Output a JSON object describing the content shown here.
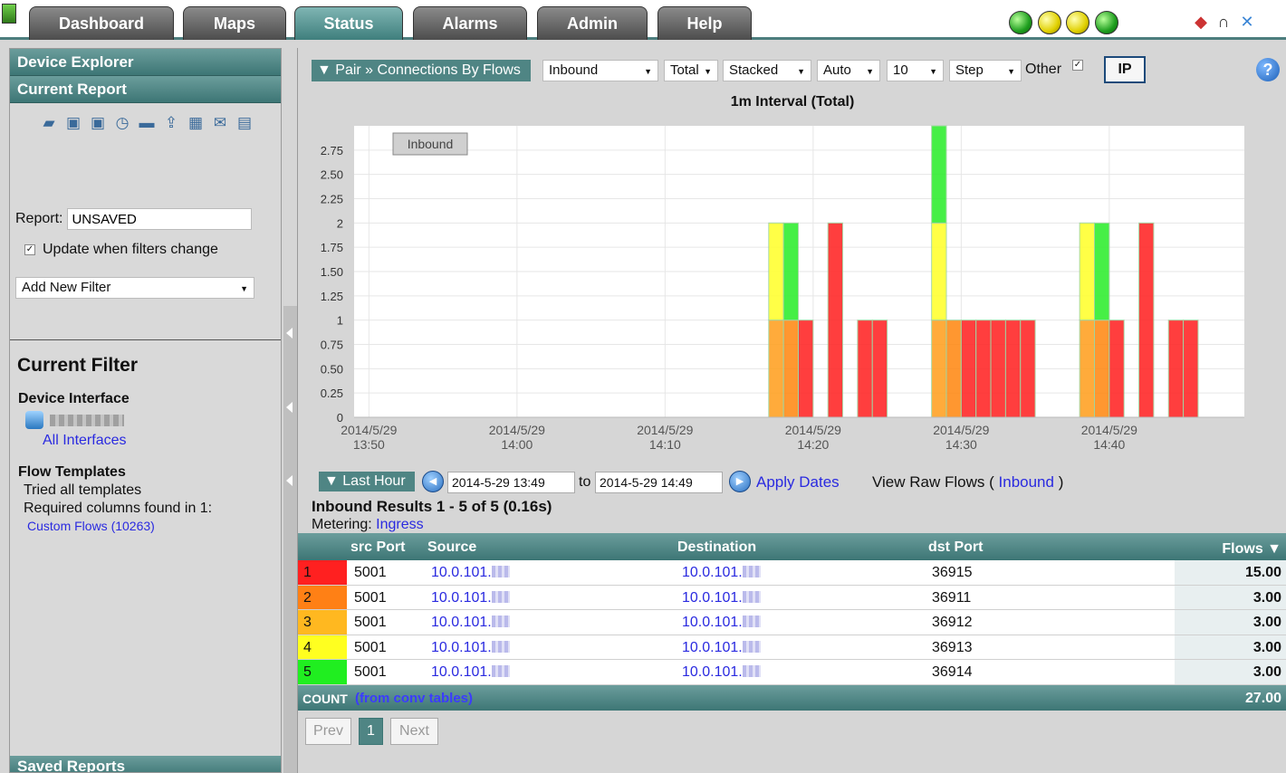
{
  "nav": {
    "tabs": [
      "Dashboard",
      "Maps",
      "Status",
      "Alarms",
      "Admin",
      "Help"
    ],
    "active_tab": "Status",
    "status_lights": [
      "green",
      "yellow",
      "yellow",
      "green"
    ],
    "tool_icons": [
      "alert-diamond-icon",
      "binoculars-icon",
      "tools-icon"
    ]
  },
  "sidebar": {
    "device_explorer": "Device Explorer",
    "current_report": "Current Report",
    "icons": [
      "open-icon",
      "save-icon",
      "save-as-icon",
      "schedule-icon",
      "print-icon",
      "export-icon",
      "table-icon",
      "email-icon",
      "pdf-icon"
    ],
    "report_label": "Report:",
    "report_value": "UNSAVED",
    "update_label": "Update when filters change",
    "update_checked": true,
    "add_filter": "Add New Filter",
    "current_filter_title": "Current Filter",
    "device_interface_label": "Device Interface",
    "all_interfaces": "All Interfaces",
    "flow_templates_label": "Flow Templates",
    "tried_all": "Tried all templates",
    "required_columns": "Required columns found in 1:",
    "custom_flows": "Custom Flows (10263)",
    "saved_reports": "Saved Reports"
  },
  "toolbar": {
    "breadcrumb": "▼ Pair » Connections By Flows",
    "direction": "Inbound",
    "total": "Total",
    "stacked": "Stacked",
    "auto": "Auto",
    "ten": "10",
    "step": "Step",
    "other_label": "Other",
    "other_checked": true,
    "ip_button": "IP",
    "help": "?"
  },
  "chart_data": {
    "type": "bar",
    "title": "1m Interval (Total)",
    "legend_label": "Inbound",
    "stacked": true,
    "ylim": [
      0,
      3
    ],
    "y_ticks": [
      "0",
      "0.25",
      "0.50",
      "0.75",
      "1",
      "1.25",
      "1.50",
      "1.75",
      "2",
      "2.25",
      "2.50",
      "2.75"
    ],
    "x_ticks": [
      [
        "2014/5/29",
        "13:50"
      ],
      [
        "2014/5/29",
        "14:00"
      ],
      [
        "2014/5/29",
        "14:10"
      ],
      [
        "2014/5/29",
        "14:20"
      ],
      [
        "2014/5/29",
        "14:30"
      ],
      [
        "2014/5/29",
        "14:40"
      ]
    ],
    "x_start": "13:49",
    "series_colors": [
      "#ff2a2a",
      "#ff8c1a",
      "#ffb833",
      "#ffff33",
      "#33ee33"
    ],
    "bars": [
      {
        "t": "14:17",
        "orange": 1,
        "yellow": 1
      },
      {
        "t": "14:18",
        "amber": 1,
        "green": 1
      },
      {
        "t": "14:19",
        "red": 1
      },
      {
        "t": "14:21",
        "red": 2
      },
      {
        "t": "14:23",
        "red": 1
      },
      {
        "t": "14:24",
        "red": 1
      },
      {
        "t": "14:28",
        "orange": 1,
        "yellow": 1,
        "green": 1
      },
      {
        "t": "14:29",
        "amber": 1
      },
      {
        "t": "14:30",
        "red": 1
      },
      {
        "t": "14:31",
        "red": 1
      },
      {
        "t": "14:32",
        "red": 1
      },
      {
        "t": "14:33",
        "red": 1
      },
      {
        "t": "14:34",
        "red": 1
      },
      {
        "t": "14:38",
        "orange": 1,
        "yellow": 1
      },
      {
        "t": "14:39",
        "amber": 1,
        "green": 1
      },
      {
        "t": "14:40",
        "red": 1
      },
      {
        "t": "14:42",
        "red": 2
      },
      {
        "t": "14:44",
        "red": 1
      },
      {
        "t": "14:45",
        "red": 1
      }
    ]
  },
  "controls": {
    "range": "▼ Last Hour",
    "from": "2014-5-29 13:49",
    "to_label": "to",
    "to": "2014-5-29 14:49",
    "apply": "Apply Dates",
    "raw_prefix": "View Raw Flows (",
    "raw_link": "Inbound",
    "raw_suffix": ")",
    "results": "Inbound Results 1 - 5 of 5 (0.16s)",
    "metering_label": "Metering:",
    "metering_link": "Ingress"
  },
  "table": {
    "headers": {
      "src_port": "src Port",
      "source": "Source",
      "destination": "Destination",
      "dst_port": "dst Port",
      "flows": "Flows ▼"
    },
    "rows": [
      {
        "idx": "1",
        "color": "#ff2020",
        "src_port": "5001",
        "source": "10.0.101.",
        "destination": "10.0.101.",
        "dst_port": "36915",
        "flows": "15.00"
      },
      {
        "idx": "2",
        "color": "#ff8015",
        "src_port": "5001",
        "source": "10.0.101.",
        "destination": "10.0.101.",
        "dst_port": "36911",
        "flows": "3.00"
      },
      {
        "idx": "3",
        "color": "#ffb820",
        "src_port": "5001",
        "source": "10.0.101.",
        "destination": "10.0.101.",
        "dst_port": "36912",
        "flows": "3.00"
      },
      {
        "idx": "4",
        "color": "#ffff20",
        "src_port": "5001",
        "source": "10.0.101.",
        "destination": "10.0.101.",
        "dst_port": "36913",
        "flows": "3.00"
      },
      {
        "idx": "5",
        "color": "#20ee20",
        "src_port": "5001",
        "source": "10.0.101.",
        "destination": "10.0.101.",
        "dst_port": "36914",
        "flows": "3.00"
      }
    ],
    "count_label": "COUNT",
    "count_link": "(from conv tables)",
    "count_value": "27.00"
  },
  "pager": {
    "prev": "Prev",
    "page": "1",
    "next": "Next"
  }
}
